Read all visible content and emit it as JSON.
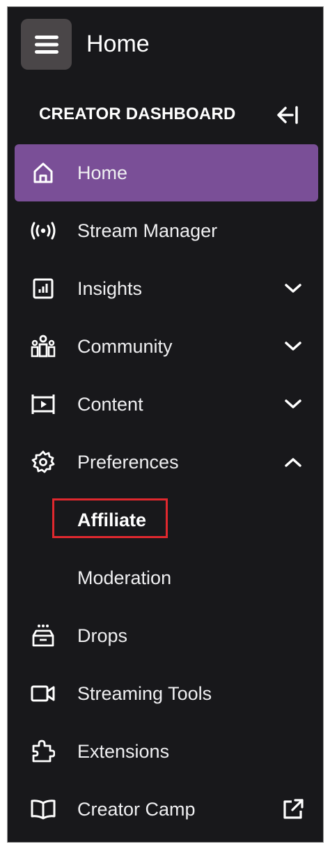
{
  "header": {
    "title": "Home",
    "menu_icon": "hamburger-menu-icon"
  },
  "sidebar": {
    "section_title": "CREATOR DASHBOARD",
    "collapse_icon": "collapse-left-icon",
    "accent_color": "#7a4f97",
    "highlight_color": "#e0282e",
    "items": [
      {
        "label": "Home",
        "icon": "home-icon",
        "active": true
      },
      {
        "label": "Stream Manager",
        "icon": "broadcast-icon"
      },
      {
        "label": "Insights",
        "icon": "insights-icon",
        "chevron": "down"
      },
      {
        "label": "Community",
        "icon": "community-icon",
        "chevron": "down"
      },
      {
        "label": "Content",
        "icon": "content-icon",
        "chevron": "down"
      },
      {
        "label": "Preferences",
        "icon": "gear-icon",
        "chevron": "up",
        "expanded": true,
        "children": [
          {
            "label": "Affiliate",
            "highlighted": true
          },
          {
            "label": "Moderation"
          }
        ]
      },
      {
        "label": "Drops",
        "icon": "drops-icon"
      },
      {
        "label": "Streaming Tools",
        "icon": "video-camera-icon"
      },
      {
        "label": "Extensions",
        "icon": "puzzle-icon"
      },
      {
        "label": "Creator Camp",
        "icon": "book-icon",
        "external_icon": "external-link-icon"
      }
    ]
  }
}
